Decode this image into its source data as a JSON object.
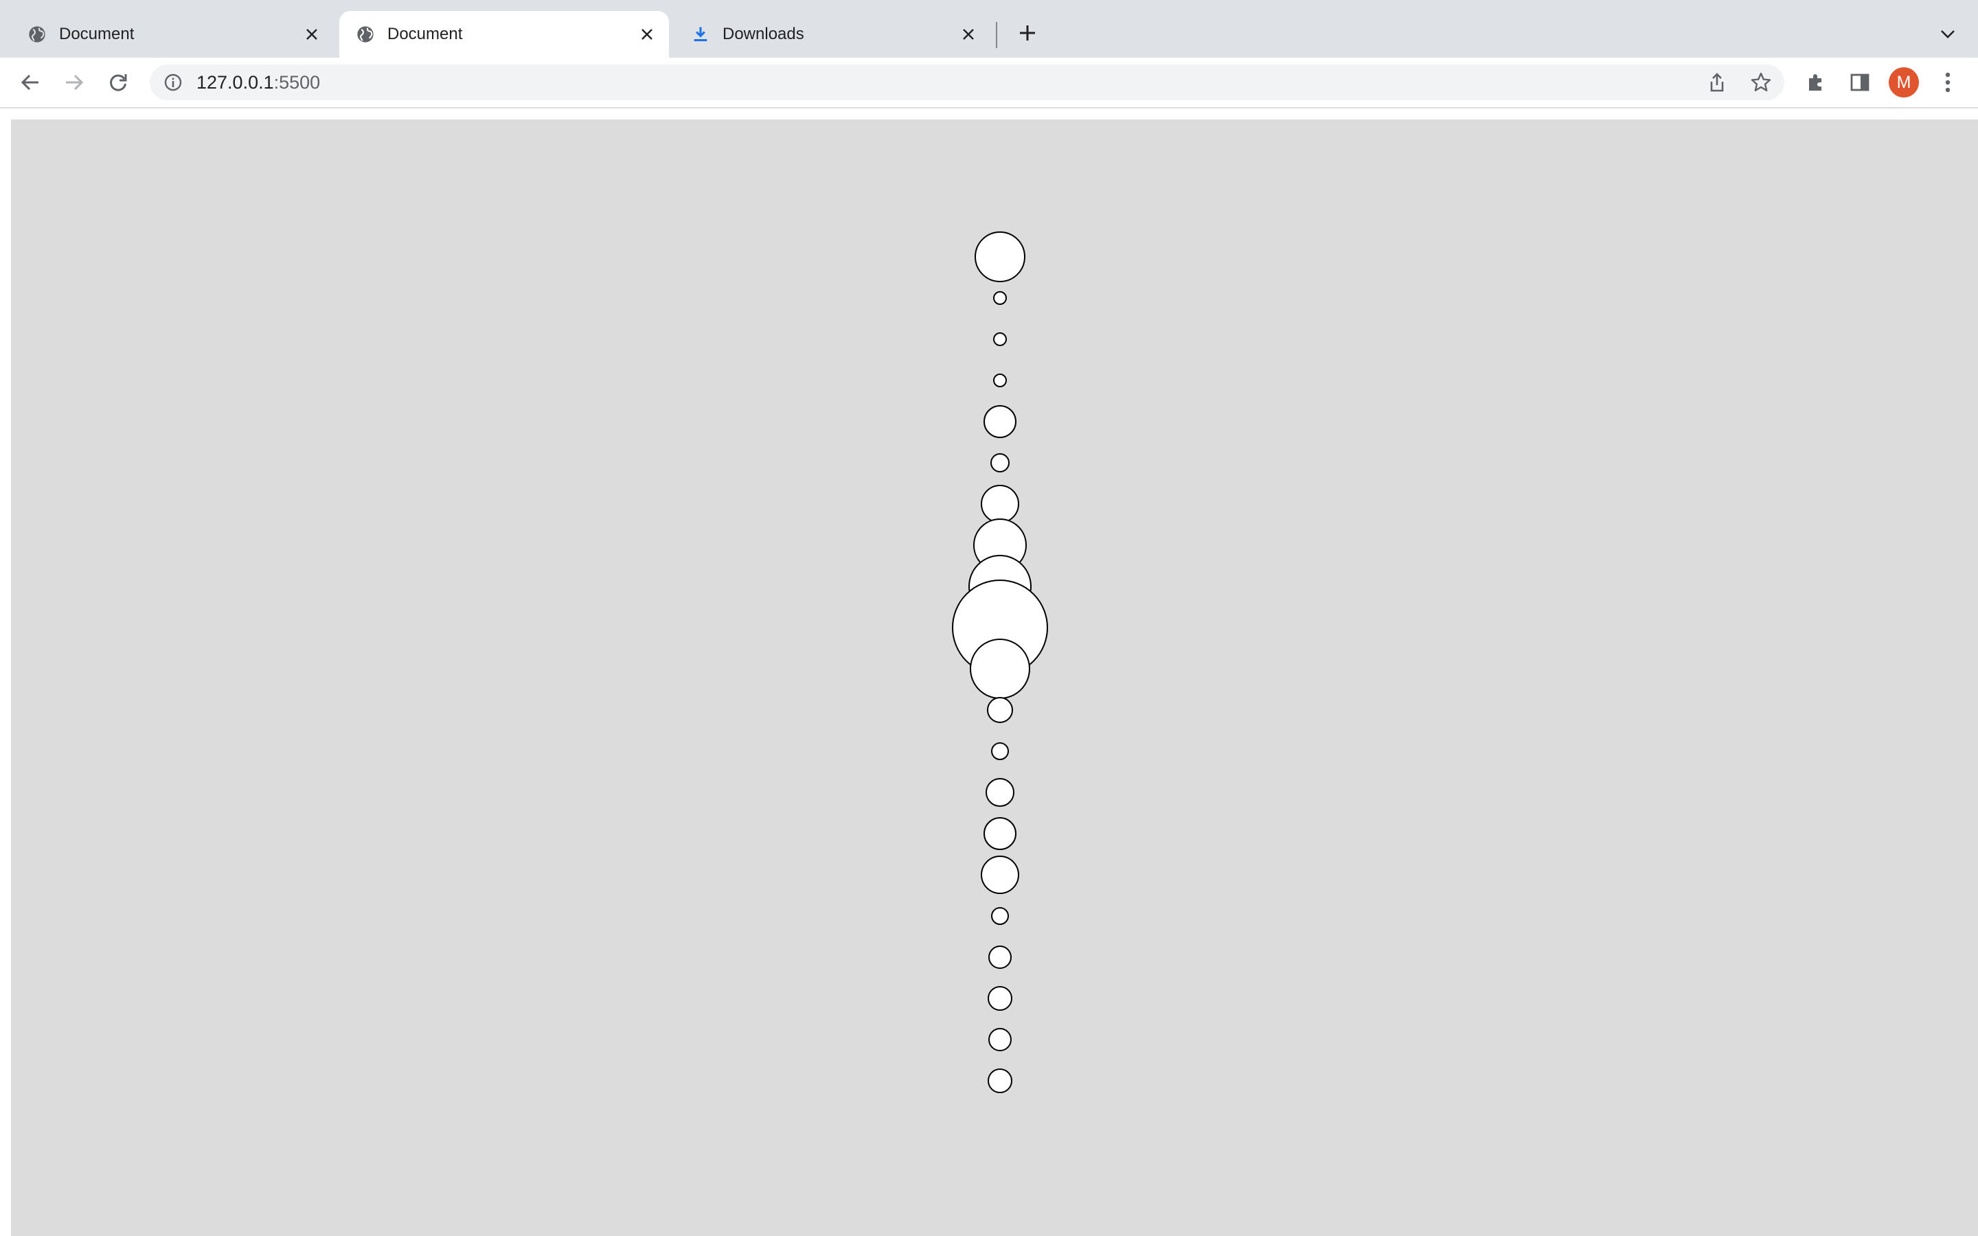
{
  "browser": {
    "tabs": [
      {
        "title": "Document",
        "icon": "globe-icon",
        "active": false
      },
      {
        "title": "Document",
        "icon": "globe-icon",
        "active": true
      },
      {
        "title": "Downloads",
        "icon": "download-icon",
        "active": false
      }
    ],
    "address": {
      "host": "127.0.0.1",
      "port": ":5500"
    },
    "profile_initial": "M",
    "colors": {
      "tabstrip": "#dee1e6",
      "avatar": "#e0552d",
      "download_icon": "#1a73e8"
    }
  },
  "page": {
    "background": "#dcdcdc",
    "circle_fill": "#ffffff",
    "circle_stroke": "#000000",
    "circles": [
      {
        "r": 36
      },
      {
        "r": 9
      },
      {
        "r": 9
      },
      {
        "r": 9
      },
      {
        "r": 23
      },
      {
        "r": 13
      },
      {
        "r": 27
      },
      {
        "r": 38
      },
      {
        "r": 45
      },
      {
        "r": 69
      },
      {
        "r": 43
      },
      {
        "r": 18
      },
      {
        "r": 12
      },
      {
        "r": 20
      },
      {
        "r": 23
      },
      {
        "r": 27
      },
      {
        "r": 12
      },
      {
        "r": 16
      },
      {
        "r": 17
      },
      {
        "r": 16
      },
      {
        "r": 17
      }
    ]
  }
}
